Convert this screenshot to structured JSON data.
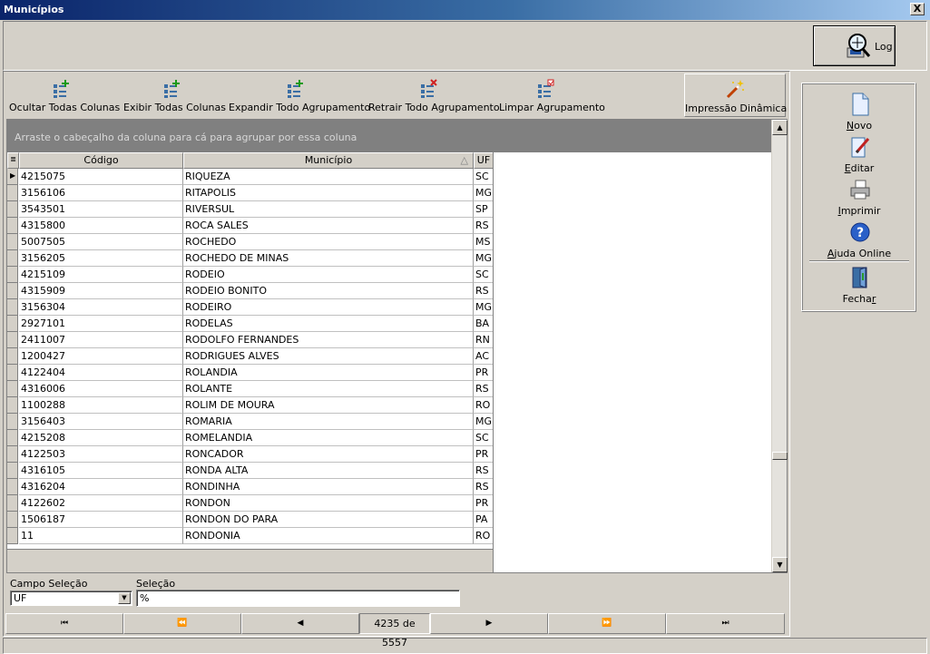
{
  "window": {
    "title": "Municípios",
    "close_label": "X"
  },
  "log_button": {
    "label": "Log",
    "icon": "magnifier-computer-icon"
  },
  "toolbar": {
    "items": [
      {
        "label": "Ocultar Todas Colunas",
        "icon": "columns-add-icon"
      },
      {
        "label": "Exibir Todas  Colunas",
        "icon": "columns-add-icon"
      },
      {
        "label": "Expandir Todo Agrupamento",
        "icon": "tree-add-icon"
      },
      {
        "label": "Retrair Todo Agrupamento",
        "icon": "tree-remove-icon"
      },
      {
        "label": "Limpar Agrupamento",
        "icon": "tree-clear-icon"
      },
      {
        "label": "Impressão Dinâmica",
        "icon": "magic-wand-icon"
      }
    ]
  },
  "grid": {
    "group_hint": "Arraste o cabeçalho da coluna para cá para agrupar por essa coluna",
    "columns": [
      "Código",
      "Município",
      "UF"
    ],
    "sort_indicator": "△",
    "rows": [
      [
        "4215075",
        "RIQUEZA",
        "SC"
      ],
      [
        "3156106",
        "RITAPOLIS",
        "MG"
      ],
      [
        "3543501",
        "RIVERSUL",
        "SP"
      ],
      [
        "4315800",
        "ROCA SALES",
        "RS"
      ],
      [
        "5007505",
        "ROCHEDO",
        "MS"
      ],
      [
        "3156205",
        "ROCHEDO DE MINAS",
        "MG"
      ],
      [
        "4215109",
        "RODEIO",
        "SC"
      ],
      [
        "4315909",
        "RODEIO BONITO",
        "RS"
      ],
      [
        "3156304",
        "RODEIRO",
        "MG"
      ],
      [
        "2927101",
        "RODELAS",
        "BA"
      ],
      [
        "2411007",
        "RODOLFO FERNANDES",
        "RN"
      ],
      [
        "1200427",
        "RODRIGUES ALVES",
        "AC"
      ],
      [
        "4122404",
        "ROLANDIA",
        "PR"
      ],
      [
        "4316006",
        "ROLANTE",
        "RS"
      ],
      [
        "1100288",
        "ROLIM DE MOURA",
        "RO"
      ],
      [
        "3156403",
        "ROMARIA",
        "MG"
      ],
      [
        "4215208",
        "ROMELANDIA",
        "SC"
      ],
      [
        "4122503",
        "RONCADOR",
        "PR"
      ],
      [
        "4316105",
        "RONDA ALTA",
        "RS"
      ],
      [
        "4316204",
        "RONDINHA",
        "RS"
      ],
      [
        "4122602",
        "RONDON",
        "PR"
      ],
      [
        "1506187",
        "RONDON DO PARA",
        "PA"
      ],
      [
        "11",
        "RONDONIA",
        "RO"
      ]
    ]
  },
  "filter": {
    "campo_label": "Campo Seleção",
    "campo_value": "UF",
    "selecao_label": "Seleção",
    "selecao_value": "%"
  },
  "navigator": {
    "position": "4235 de 5557"
  },
  "side_actions": [
    {
      "label": "Novo",
      "key": "N",
      "icon": "new-document-icon"
    },
    {
      "label": "Editar",
      "key": "E",
      "icon": "edit-pencil-icon"
    },
    {
      "label": "Imprimir",
      "key": "I",
      "icon": "printer-icon"
    },
    {
      "label": "Ajuda Online",
      "key": "A",
      "icon": "help-icon"
    },
    {
      "label": "Fechar",
      "key": "r",
      "icon": "exit-door-icon"
    }
  ]
}
